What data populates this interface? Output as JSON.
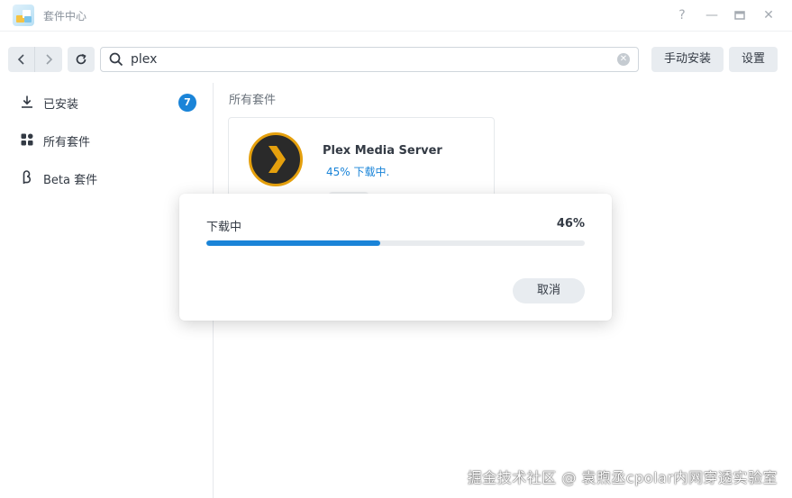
{
  "window": {
    "title": "套件中心",
    "help_glyph": "?",
    "minimize_glyph": "—",
    "maximize_glyph": "▭",
    "close_glyph": "✕"
  },
  "toolbar": {
    "search_value": "plex",
    "manual_install_label": "手动安装",
    "settings_label": "设置"
  },
  "sidebar": {
    "items": [
      {
        "label": "已安装",
        "icon": "download-icon",
        "badge": "7"
      },
      {
        "label": "所有套件",
        "icon": "grid-icon"
      },
      {
        "label": "Beta 套件",
        "icon": "beta-icon"
      }
    ]
  },
  "main": {
    "section_title": "所有套件",
    "package": {
      "name": "Plex Media Server",
      "status": "45% 下载中."
    }
  },
  "modal": {
    "label": "下载中",
    "percent_text": "46%",
    "progress": 0.46,
    "cancel_label": "取消"
  },
  "watermark": "掘金技术社区 @ 袁煦丞cpolar内网穿透实验室",
  "colors": {
    "accent": "#1a84d8",
    "plex_orange": "#e5a00d"
  }
}
